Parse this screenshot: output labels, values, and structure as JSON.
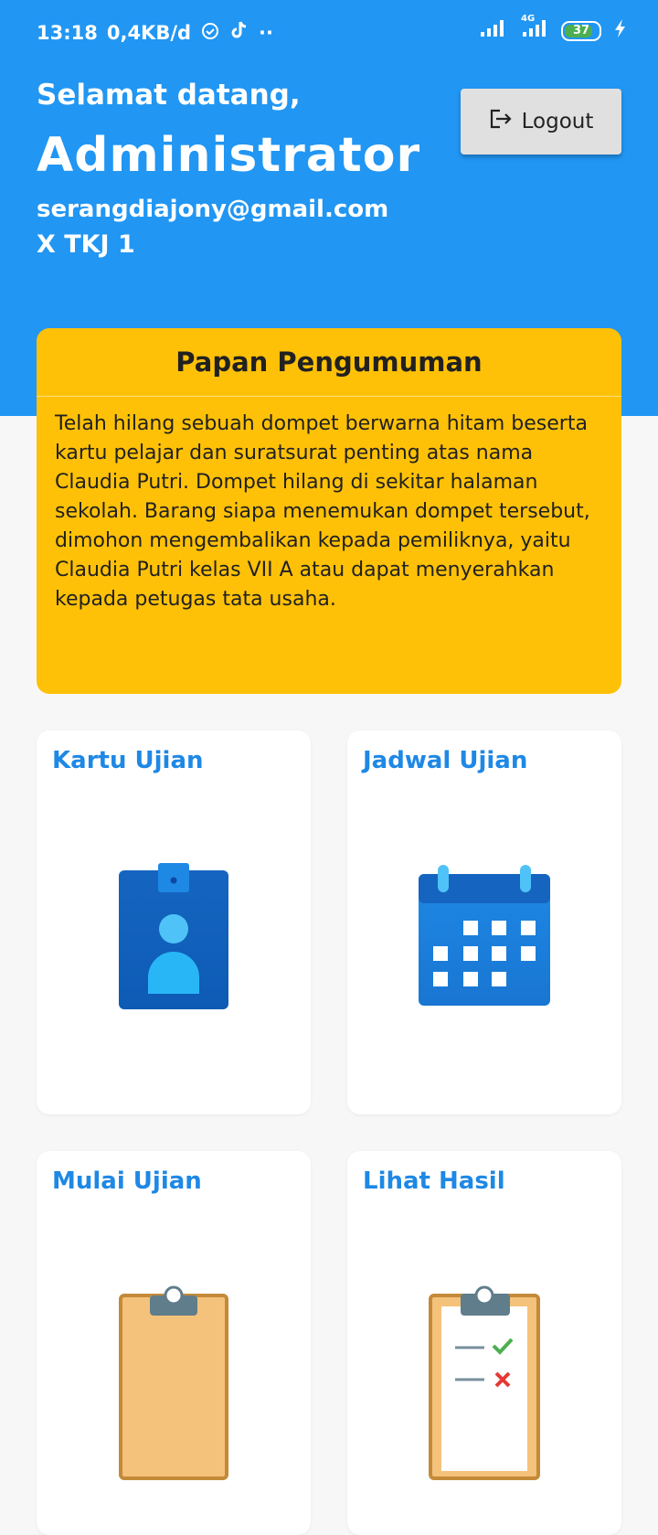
{
  "status_bar": {
    "time": "13:18",
    "network_speed": "0,4KB/d",
    "network_type": "4G",
    "battery": "37"
  },
  "header": {
    "welcome": "Selamat datang,",
    "name": "Administrator",
    "email": "serangdiajony@gmail.com",
    "class": "X TKJ 1",
    "logout_label": "Logout"
  },
  "announcement": {
    "title": "Papan Pengumuman",
    "body": "Telah hilang sebuah dompet berwarna hitam beserta kartu pelajar dan suratsurat penting atas nama Claudia Putri. Dompet hilang di sekitar halaman sekolah. Barang siapa menemukan dompet tersebut, dimohon mengembalikan kepada pemiliknya, yaitu Claudia Putri kelas VII A atau dapat menyerahkan kepada petugas tata usaha."
  },
  "menu": {
    "items": [
      {
        "label": "Kartu Ujian",
        "icon": "id-card-icon"
      },
      {
        "label": "Jadwal Ujian",
        "icon": "calendar-icon"
      },
      {
        "label": "Mulai Ujian",
        "icon": "clipboard-icon"
      },
      {
        "label": "Lihat Hasil",
        "icon": "checklist-clipboard-icon"
      }
    ]
  },
  "colors": {
    "primary": "#2196f3",
    "announcement": "#ffc107",
    "card_title": "#1e88e5",
    "background": "#f7f7f7"
  }
}
